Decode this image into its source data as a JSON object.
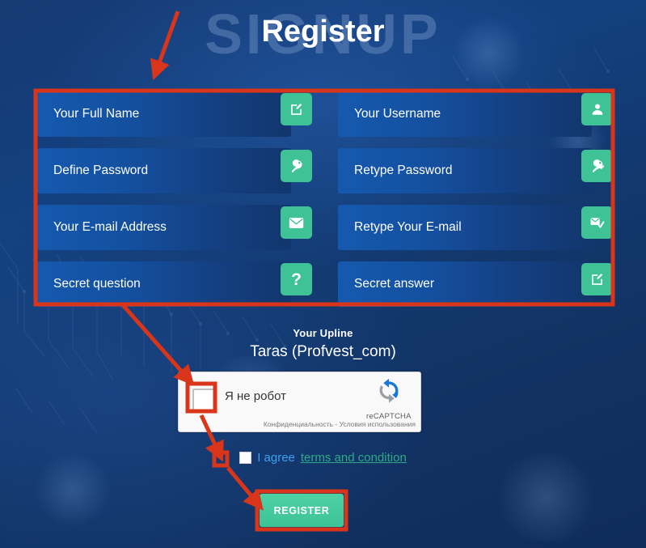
{
  "header": {
    "watermark": "SIGNUP",
    "title": "Register"
  },
  "form": {
    "fields": [
      {
        "label": "Your Full Name",
        "icon": "edit-square-icon"
      },
      {
        "label": "Your Username",
        "icon": "user-icon"
      },
      {
        "label": "Define Password",
        "icon": "key-icon"
      },
      {
        "label": "Retype Password",
        "icon": "key-check-icon"
      },
      {
        "label": "Your E-mail Address",
        "icon": "envelope-icon"
      },
      {
        "label": "Retype Your E-mail",
        "icon": "envelope-check-icon"
      },
      {
        "label": "Secret question",
        "icon": "question-mark-icon"
      },
      {
        "label": "Secret answer",
        "icon": "edit-square-icon"
      }
    ]
  },
  "upline": {
    "label": "Your Upline",
    "name": "Taras (Profvest_com)"
  },
  "recaptcha": {
    "checkbox_label": "Я не робот",
    "brand": "reCAPTCHA",
    "legal": "Конфиденциальность - Условия использования",
    "logo_icon": "recaptcha-arrows-icon",
    "checked": false
  },
  "agree": {
    "text": "I agree",
    "link": "terms and condition",
    "checked": false
  },
  "actions": {
    "register_label": "REGISTER"
  },
  "colors": {
    "accent_green": "#3fc296",
    "field_blue": "#1559ae",
    "page_blue": "#123567",
    "annotation_red": "#d8351a",
    "link_blue": "#3da0f0",
    "link_green": "#2fa885"
  },
  "annotations": {
    "arrow_to_form": "arrow-down-left",
    "form_box": "highlight-rectangle",
    "arrow_to_captcha": "arrow-down-right",
    "arrow_to_agree": "arrow-down-right",
    "arrow_to_register": "arrow-down-right",
    "captcha_box": "highlight-square",
    "agree_box": "highlight-square",
    "register_box": "highlight-rectangle"
  }
}
